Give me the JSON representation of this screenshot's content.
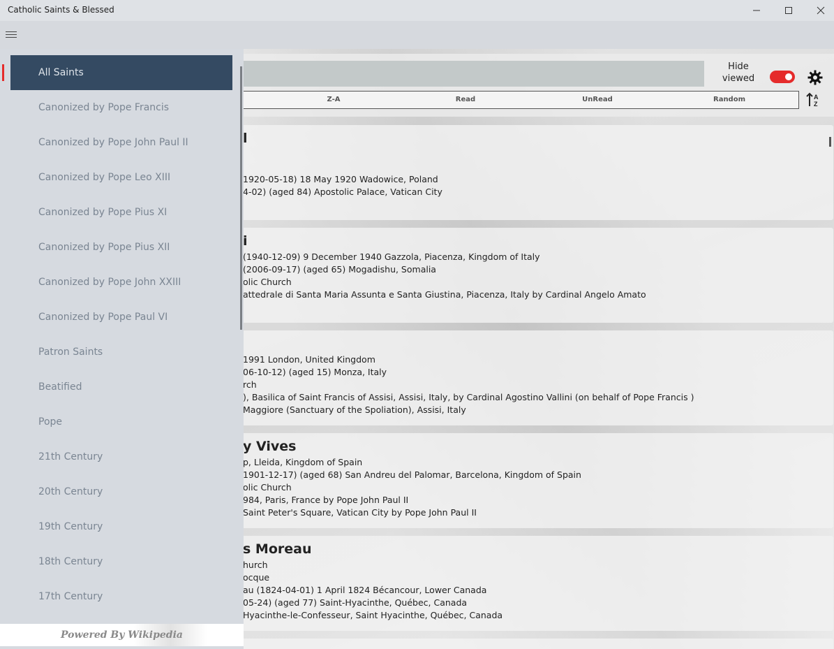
{
  "window": {
    "title": "Catholic Saints & Blessed"
  },
  "toolbar": {
    "hide_viewed_label": "Hide viewed",
    "hide_viewed_on": true,
    "sort_options": [
      "Z-A",
      "Read",
      "UnRead",
      "Random"
    ]
  },
  "drawer": {
    "items": [
      "All Saints",
      "Canonized by Pope Francis",
      "Canonized by Pope John Paul II",
      "Canonized by Pope Leo XIII",
      "Canonized by Pope Pius XI",
      "Canonized by Pope Pius XII",
      "Canonized by Pope John XXIII",
      "Canonized by Pope Paul VI",
      "Patron Saints",
      "Beatified",
      "Pope",
      "21th Century",
      "20th Century",
      "19th Century",
      "18th Century",
      "17th Century"
    ],
    "active_index": 0,
    "powered_by": "Powered By Wikipedia"
  },
  "cards": [
    {
      "title": "l",
      "lines": [
        "",
        "1920-05-18) 18 May 1920 Wadowice, Poland",
        "4-02) (aged 84) Apostolic Palace, Vatican City"
      ]
    },
    {
      "title": "i",
      "lines": [
        "(1940-12-09) 9 December 1940 Gazzola, Piacenza, Kingdom of Italy",
        "(2006-09-17) (aged 65) Mogadishu, Somalia",
        "olic Church",
        "attedrale di Santa Maria Assunta e Santa Giustina, Piacenza, Italy by Cardinal Angelo Amato"
      ]
    },
    {
      "title": "",
      "lines": [
        "1991 London, United Kingdom",
        "06-10-12) (aged 15) Monza, Italy",
        "rch",
        "), Basilica of Saint Francis of Assisi, Assisi, Italy, by Cardinal Agostino Vallini (on behalf of Pope Francis )",
        "Maggiore (Sanctuary of the Spoliation), Assisi, Italy"
      ]
    },
    {
      "title": "y Vives",
      "lines": [
        "p, Lleida, Kingdom of Spain",
        "1901-12-17) (aged 68) San Andreu del Palomar, Barcelona, Kingdom of Spain",
        "olic Church",
        "984, Paris, France by Pope John Paul II",
        "Saint Peter's Square, Vatican City by Pope John Paul II"
      ]
    },
    {
      "title": "s Moreau",
      "lines": [
        "hurch",
        "ocque",
        "au (1824-04-01) 1 April 1824 Bécancour, Lower Canada",
        "05-24) (aged 77) Saint-Hyacinthe, Québec, Canada",
        "Hyacinthe-le-Confesseur, Saint Hyacinthe, Québec, Canada"
      ]
    }
  ]
}
